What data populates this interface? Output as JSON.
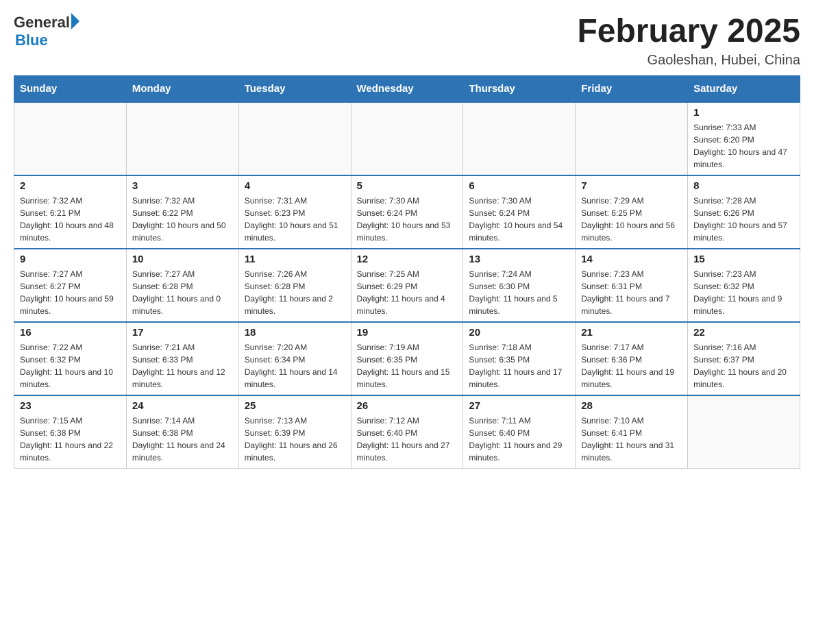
{
  "header": {
    "logo_general": "General",
    "logo_blue": "Blue",
    "month_title": "February 2025",
    "location": "Gaoleshan, Hubei, China"
  },
  "days_of_week": [
    "Sunday",
    "Monday",
    "Tuesday",
    "Wednesday",
    "Thursday",
    "Friday",
    "Saturday"
  ],
  "weeks": [
    {
      "days": [
        {
          "num": "",
          "info": ""
        },
        {
          "num": "",
          "info": ""
        },
        {
          "num": "",
          "info": ""
        },
        {
          "num": "",
          "info": ""
        },
        {
          "num": "",
          "info": ""
        },
        {
          "num": "",
          "info": ""
        },
        {
          "num": "1",
          "info": "Sunrise: 7:33 AM\nSunset: 6:20 PM\nDaylight: 10 hours and 47 minutes."
        }
      ]
    },
    {
      "days": [
        {
          "num": "2",
          "info": "Sunrise: 7:32 AM\nSunset: 6:21 PM\nDaylight: 10 hours and 48 minutes."
        },
        {
          "num": "3",
          "info": "Sunrise: 7:32 AM\nSunset: 6:22 PM\nDaylight: 10 hours and 50 minutes."
        },
        {
          "num": "4",
          "info": "Sunrise: 7:31 AM\nSunset: 6:23 PM\nDaylight: 10 hours and 51 minutes."
        },
        {
          "num": "5",
          "info": "Sunrise: 7:30 AM\nSunset: 6:24 PM\nDaylight: 10 hours and 53 minutes."
        },
        {
          "num": "6",
          "info": "Sunrise: 7:30 AM\nSunset: 6:24 PM\nDaylight: 10 hours and 54 minutes."
        },
        {
          "num": "7",
          "info": "Sunrise: 7:29 AM\nSunset: 6:25 PM\nDaylight: 10 hours and 56 minutes."
        },
        {
          "num": "8",
          "info": "Sunrise: 7:28 AM\nSunset: 6:26 PM\nDaylight: 10 hours and 57 minutes."
        }
      ]
    },
    {
      "days": [
        {
          "num": "9",
          "info": "Sunrise: 7:27 AM\nSunset: 6:27 PM\nDaylight: 10 hours and 59 minutes."
        },
        {
          "num": "10",
          "info": "Sunrise: 7:27 AM\nSunset: 6:28 PM\nDaylight: 11 hours and 0 minutes."
        },
        {
          "num": "11",
          "info": "Sunrise: 7:26 AM\nSunset: 6:28 PM\nDaylight: 11 hours and 2 minutes."
        },
        {
          "num": "12",
          "info": "Sunrise: 7:25 AM\nSunset: 6:29 PM\nDaylight: 11 hours and 4 minutes."
        },
        {
          "num": "13",
          "info": "Sunrise: 7:24 AM\nSunset: 6:30 PM\nDaylight: 11 hours and 5 minutes."
        },
        {
          "num": "14",
          "info": "Sunrise: 7:23 AM\nSunset: 6:31 PM\nDaylight: 11 hours and 7 minutes."
        },
        {
          "num": "15",
          "info": "Sunrise: 7:23 AM\nSunset: 6:32 PM\nDaylight: 11 hours and 9 minutes."
        }
      ]
    },
    {
      "days": [
        {
          "num": "16",
          "info": "Sunrise: 7:22 AM\nSunset: 6:32 PM\nDaylight: 11 hours and 10 minutes."
        },
        {
          "num": "17",
          "info": "Sunrise: 7:21 AM\nSunset: 6:33 PM\nDaylight: 11 hours and 12 minutes."
        },
        {
          "num": "18",
          "info": "Sunrise: 7:20 AM\nSunset: 6:34 PM\nDaylight: 11 hours and 14 minutes."
        },
        {
          "num": "19",
          "info": "Sunrise: 7:19 AM\nSunset: 6:35 PM\nDaylight: 11 hours and 15 minutes."
        },
        {
          "num": "20",
          "info": "Sunrise: 7:18 AM\nSunset: 6:35 PM\nDaylight: 11 hours and 17 minutes."
        },
        {
          "num": "21",
          "info": "Sunrise: 7:17 AM\nSunset: 6:36 PM\nDaylight: 11 hours and 19 minutes."
        },
        {
          "num": "22",
          "info": "Sunrise: 7:16 AM\nSunset: 6:37 PM\nDaylight: 11 hours and 20 minutes."
        }
      ]
    },
    {
      "days": [
        {
          "num": "23",
          "info": "Sunrise: 7:15 AM\nSunset: 6:38 PM\nDaylight: 11 hours and 22 minutes."
        },
        {
          "num": "24",
          "info": "Sunrise: 7:14 AM\nSunset: 6:38 PM\nDaylight: 11 hours and 24 minutes."
        },
        {
          "num": "25",
          "info": "Sunrise: 7:13 AM\nSunset: 6:39 PM\nDaylight: 11 hours and 26 minutes."
        },
        {
          "num": "26",
          "info": "Sunrise: 7:12 AM\nSunset: 6:40 PM\nDaylight: 11 hours and 27 minutes."
        },
        {
          "num": "27",
          "info": "Sunrise: 7:11 AM\nSunset: 6:40 PM\nDaylight: 11 hours and 29 minutes."
        },
        {
          "num": "28",
          "info": "Sunrise: 7:10 AM\nSunset: 6:41 PM\nDaylight: 11 hours and 31 minutes."
        },
        {
          "num": "",
          "info": ""
        }
      ]
    }
  ]
}
